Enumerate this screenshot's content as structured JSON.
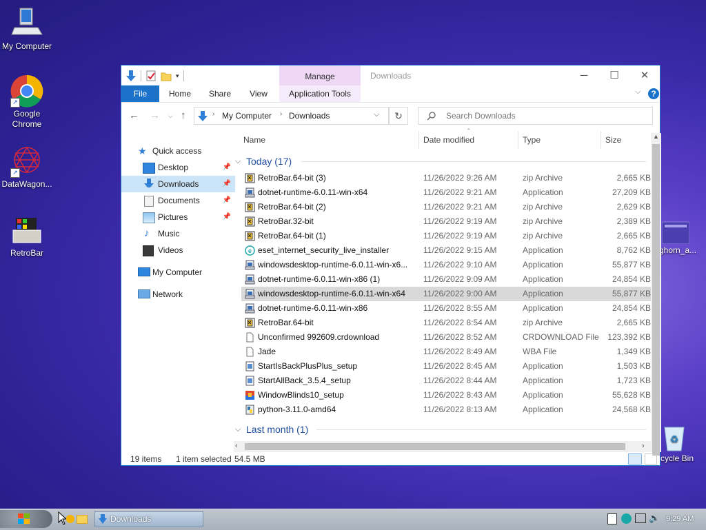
{
  "desktop": {
    "icons": [
      {
        "label": "My Computer"
      },
      {
        "label": "Google Chrome"
      },
      {
        "label": "DataWagon..."
      },
      {
        "label": "RetroBar"
      },
      {
        "label": "ghorn_a..."
      },
      {
        "label": "cycle Bin"
      }
    ]
  },
  "window": {
    "title": "Downloads",
    "manage_tab": "Manage",
    "ribbon_tabs": [
      "File",
      "Home",
      "Share",
      "View",
      "Application Tools"
    ],
    "breadcrumb": [
      "My Computer",
      "Downloads"
    ],
    "search_placeholder": "Search Downloads",
    "help": "?"
  },
  "nav": {
    "quick_access": "Quick access",
    "items": [
      "Desktop",
      "Downloads",
      "Documents",
      "Pictures",
      "Music",
      "Videos"
    ],
    "my_computer": "My Computer",
    "network": "Network"
  },
  "columns": [
    "Name",
    "Date modified",
    "Type",
    "Size"
  ],
  "groups": {
    "today": "Today (17)",
    "last_month": "Last month (1)"
  },
  "files": [
    {
      "name": "RetroBar.64-bit (3)",
      "date": "11/26/2022 9:26 AM",
      "type": "zip Archive",
      "size": "2,665 KB",
      "icon": "zip-icon"
    },
    {
      "name": "dotnet-runtime-6.0.11-win-x64",
      "date": "11/26/2022 9:21 AM",
      "type": "Application",
      "size": "27,209 KB",
      "icon": "installer-icon"
    },
    {
      "name": "RetroBar.64-bit (2)",
      "date": "11/26/2022 9:21 AM",
      "type": "zip Archive",
      "size": "2,629 KB",
      "icon": "zip-icon"
    },
    {
      "name": "RetroBar.32-bit",
      "date": "11/26/2022 9:19 AM",
      "type": "zip Archive",
      "size": "2,389 KB",
      "icon": "zip-icon"
    },
    {
      "name": "RetroBar.64-bit (1)",
      "date": "11/26/2022 9:19 AM",
      "type": "zip Archive",
      "size": "2,665 KB",
      "icon": "zip-icon"
    },
    {
      "name": "eset_internet_security_live_installer",
      "date": "11/26/2022 9:15 AM",
      "type": "Application",
      "size": "8,762 KB",
      "icon": "eset-icon"
    },
    {
      "name": "windowsdesktop-runtime-6.0.11-win-x6...",
      "date": "11/26/2022 9:10 AM",
      "type": "Application",
      "size": "55,877 KB",
      "icon": "installer-icon"
    },
    {
      "name": "dotnet-runtime-6.0.11-win-x86 (1)",
      "date": "11/26/2022 9:09 AM",
      "type": "Application",
      "size": "24,854 KB",
      "icon": "installer-icon"
    },
    {
      "name": "windowsdesktop-runtime-6.0.11-win-x64",
      "date": "11/26/2022 9:00 AM",
      "type": "Application",
      "size": "55,877 KB",
      "icon": "installer-icon",
      "selected": true
    },
    {
      "name": "dotnet-runtime-6.0.11-win-x86",
      "date": "11/26/2022 8:55 AM",
      "type": "Application",
      "size": "24,854 KB",
      "icon": "installer-icon"
    },
    {
      "name": "RetroBar.64-bit",
      "date": "11/26/2022 8:54 AM",
      "type": "zip Archive",
      "size": "2,665 KB",
      "icon": "zip-icon"
    },
    {
      "name": "Unconfirmed 992609.crdownload",
      "date": "11/26/2022 8:52 AM",
      "type": "CRDOWNLOAD File",
      "size": "123,392 KB",
      "icon": "blank-file-icon"
    },
    {
      "name": "Jade",
      "date": "11/26/2022 8:49 AM",
      "type": "WBA File",
      "size": "1,349 KB",
      "icon": "blank-file-icon"
    },
    {
      "name": "StartIsBackPlusPlus_setup",
      "date": "11/26/2022 8:45 AM",
      "type": "Application",
      "size": "1,503 KB",
      "icon": "setup-icon"
    },
    {
      "name": "StartAllBack_3.5.4_setup",
      "date": "11/26/2022 8:44 AM",
      "type": "Application",
      "size": "1,723 KB",
      "icon": "setup-icon"
    },
    {
      "name": "WindowBlinds10_setup",
      "date": "11/26/2022 8:43 AM",
      "type": "Application",
      "size": "55,628 KB",
      "icon": "windowblinds-icon"
    },
    {
      "name": "python-3.11.0-amd64",
      "date": "11/26/2022 8:13 AM",
      "type": "Application",
      "size": "24,568 KB",
      "icon": "python-icon"
    }
  ],
  "status": {
    "items": "19 items",
    "selected": "1 item selected",
    "size": "54.5 MB"
  },
  "taskbar": {
    "window_button": "Downloads",
    "clock": "9:29 AM"
  },
  "colors": {
    "accent": "#1a73c8",
    "manage_tab": "#efd8f6",
    "selection": "#cce4f7",
    "row_selected": "#d9d9d9"
  }
}
